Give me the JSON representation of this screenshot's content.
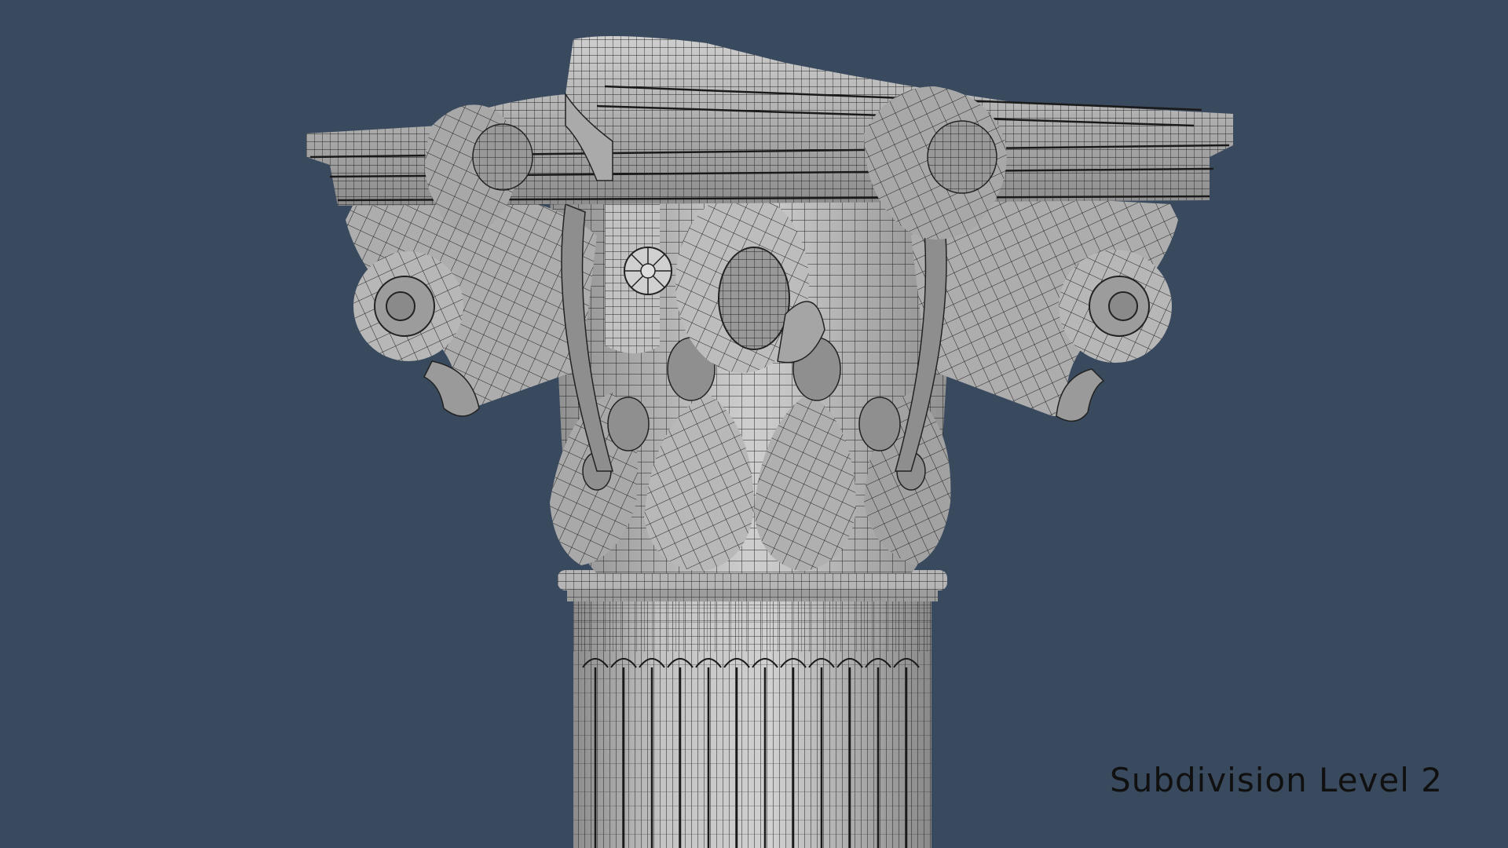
{
  "viewport": {
    "label": "Subdivision Level 2",
    "background_color": "#3a4a5e",
    "model_color": "#bfbfbf",
    "wire_color": "#2a2a2a"
  }
}
